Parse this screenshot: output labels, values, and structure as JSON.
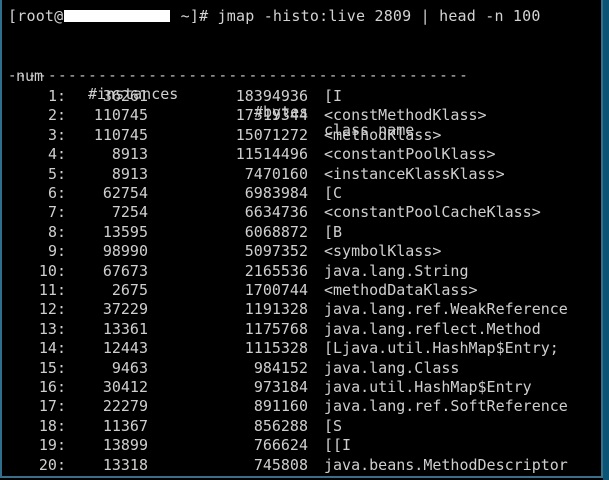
{
  "terminal": {
    "prompt_prefix": "[root@",
    "prompt_suffix": " ~]# jmap -histo:live 2809 | head -n 100",
    "headers": {
      "num": "num",
      "instances": "#instances",
      "bytes": "#bytes",
      "class": "class name"
    },
    "separator": "----------------------------------------------",
    "rows": [
      {
        "num": "1:",
        "instances": "36261",
        "bytes": "18394936",
        "class": "[I"
      },
      {
        "num": "2:",
        "instances": "110745",
        "bytes": "17319344",
        "class": "<constMethodKlass>"
      },
      {
        "num": "3:",
        "instances": "110745",
        "bytes": "15071272",
        "class": "<methodKlass>"
      },
      {
        "num": "4:",
        "instances": "8913",
        "bytes": "11514496",
        "class": "<constantPoolKlass>"
      },
      {
        "num": "5:",
        "instances": "8913",
        "bytes": "7470160",
        "class": "<instanceKlassKlass>"
      },
      {
        "num": "6:",
        "instances": "62754",
        "bytes": "6983984",
        "class": "[C"
      },
      {
        "num": "7:",
        "instances": "7254",
        "bytes": "6634736",
        "class": "<constantPoolCacheKlass>"
      },
      {
        "num": "8:",
        "instances": "13595",
        "bytes": "6068872",
        "class": "[B"
      },
      {
        "num": "9:",
        "instances": "98990",
        "bytes": "5097352",
        "class": "<symbolKlass>"
      },
      {
        "num": "10:",
        "instances": "67673",
        "bytes": "2165536",
        "class": "java.lang.String"
      },
      {
        "num": "11:",
        "instances": "2675",
        "bytes": "1700744",
        "class": "<methodDataKlass>"
      },
      {
        "num": "12:",
        "instances": "37229",
        "bytes": "1191328",
        "class": "java.lang.ref.WeakReference"
      },
      {
        "num": "13:",
        "instances": "13361",
        "bytes": "1175768",
        "class": "java.lang.reflect.Method"
      },
      {
        "num": "14:",
        "instances": "12443",
        "bytes": "1115328",
        "class": "[Ljava.util.HashMap$Entry;"
      },
      {
        "num": "15:",
        "instances": "9463",
        "bytes": "984152",
        "class": "java.lang.Class"
      },
      {
        "num": "16:",
        "instances": "30412",
        "bytes": "973184",
        "class": "java.util.HashMap$Entry"
      },
      {
        "num": "17:",
        "instances": "22279",
        "bytes": "891160",
        "class": "java.lang.ref.SoftReference"
      },
      {
        "num": "18:",
        "instances": "11367",
        "bytes": "856288",
        "class": "[S"
      },
      {
        "num": "19:",
        "instances": "13899",
        "bytes": "766624",
        "class": "[[I"
      },
      {
        "num": "20:",
        "instances": "13318",
        "bytes": "745808",
        "class": "java.beans.MethodDescriptor"
      }
    ]
  }
}
